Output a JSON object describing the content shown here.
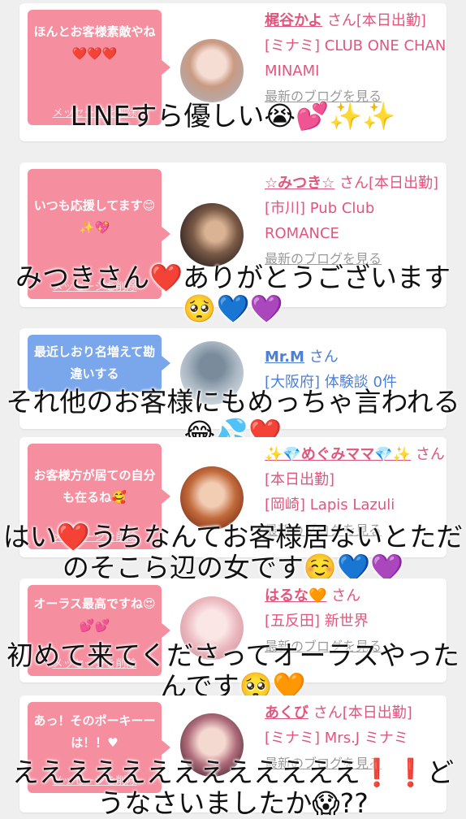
{
  "delete_label": "メッセージを削除",
  "colors": {
    "pink": "#f58e9f",
    "blue": "#7aa6ec",
    "name_pink": "#e0567d",
    "name_blue": "#4d7fd6",
    "link_gray": "#9a9a9a"
  },
  "cards": [
    {
      "message": "ほんとお客様素敵やね❤️❤️❤️",
      "name": "梶谷かよ",
      "suffix": " さん[本日出勤]",
      "shop": "[ミナミ] CLUB ONE CHAN MINAMI",
      "link": "最新のブログを見る",
      "caption": "LINEすら優しい😭💕✨✨"
    },
    {
      "message": "いつも応援してます😊✨💖",
      "name": "☆みつき☆",
      "suffix": " さん[本日出勤]",
      "shop": "[市川] Pub Club ROMANCE",
      "link": "最新のブログを見る",
      "caption": "みつきさん❤️ありがとうございます🥺💙💜"
    },
    {
      "message": "最近しおり名増えて勘違いする",
      "name": "Mr.M",
      "suffix": " さん",
      "shop": "[大阪府] 体験談 0件",
      "link": "",
      "caption": "それ他のお客様にもめっちゃ言われる😂💦❤️"
    },
    {
      "message": "お客様方が居ての自分も在るね🥰",
      "name": "✨💎めぐみママ💎✨",
      "suffix": " さん[本日出勤]",
      "shop": "[岡崎] Lapis Lazuli",
      "link": "最新のブログを見る",
      "caption": "はい❤️うちなんてお客様居ないとただのそこら辺の女です☺️💙💜"
    },
    {
      "message": "オーラス最高ですね😍💕💕",
      "name": "はるな🧡",
      "suffix": " さん",
      "shop": "[五反田] 新世界",
      "link": "最新のブログを見る",
      "caption": "初めて来てくださってオーラスやったんです🥺🧡"
    },
    {
      "message": "あっ！そのポーキーーは！！♥",
      "name": "あくび",
      "suffix": " さん[本日出勤]",
      "shop": "[ミナミ] Mrs.J ミナミ",
      "link": "最新のブログを見る",
      "caption": "えええええええええええええ❗️❗️どうなさいましたか😱??"
    }
  ]
}
